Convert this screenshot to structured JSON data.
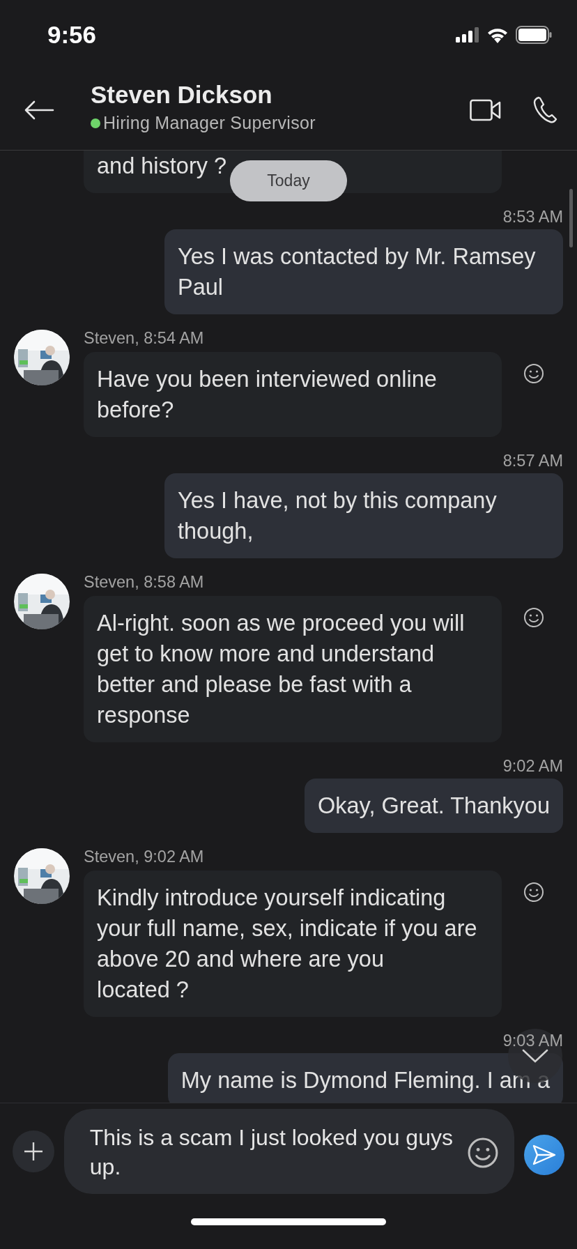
{
  "status_bar": {
    "time": "9:56"
  },
  "header": {
    "title": "Steven Dickson",
    "subtitle": "Hiring Manager Supervisor",
    "online": true
  },
  "date_chip": "Today",
  "messages": [
    {
      "kind": "incoming_cut",
      "text": "and history ?"
    },
    {
      "kind": "outgoing",
      "time": "8:53 AM",
      "text": "Yes I was contacted by Mr. Ramsey Paul"
    },
    {
      "kind": "incoming",
      "meta": "Steven, 8:54 AM",
      "text": "Have you been interviewed online before?"
    },
    {
      "kind": "outgoing",
      "time": "8:57 AM",
      "text": "Yes I have, not by this company though,"
    },
    {
      "kind": "incoming",
      "meta": "Steven, 8:58 AM",
      "text": "Al-right. soon as we proceed you will get to know more and understand better and please be fast with a response"
    },
    {
      "kind": "outgoing",
      "time": "9:02 AM",
      "text": "Okay, Great. Thankyou"
    },
    {
      "kind": "incoming",
      "meta": "Steven, 9:02 AM",
      "text": "Kindly introduce yourself indicating your full name, sex, indicate if you are above 20 and where are you\nlocated ?"
    },
    {
      "kind": "outgoing",
      "time": "9:03 AM",
      "text": "My name is Dymond Fleming. I am a"
    }
  ],
  "composer": {
    "value": "This is a scam I just looked you guys up."
  }
}
